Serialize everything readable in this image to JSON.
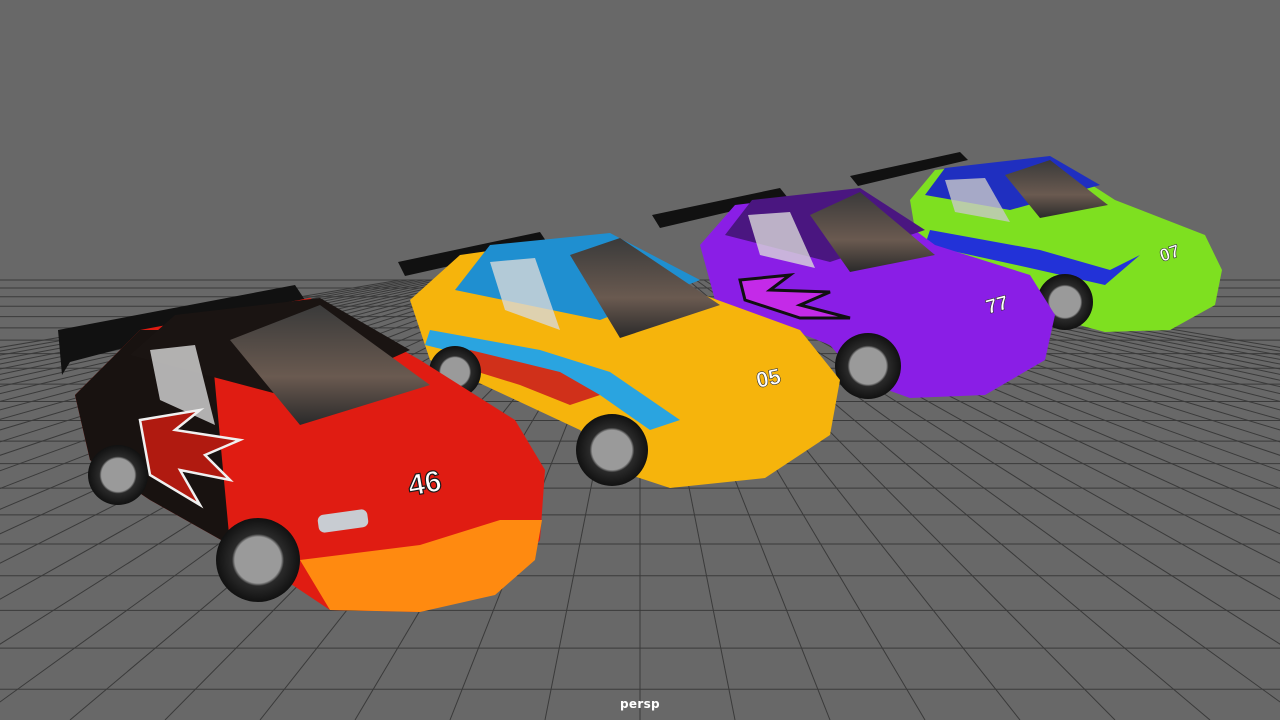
{
  "viewport": {
    "camera_label": "persp",
    "background_color": "#686868",
    "grid_color": "#3a3a3a"
  },
  "cars": [
    {
      "number": "46",
      "body_color": "#e01c12",
      "accent_color": "#ff8a10",
      "roof_color": "#1a1412",
      "decal": "flames"
    },
    {
      "number": "05",
      "body_color": "#f6b40c",
      "accent_color": "#2aa4e0",
      "roof_color": "#1f8fd0",
      "decal": "stripes"
    },
    {
      "number": "77",
      "body_color": "#8a1ee6",
      "accent_color": "#c42ae8",
      "roof_color": "#4a1680",
      "decal": "flames"
    },
    {
      "number": "07",
      "body_color": "#7ee020",
      "accent_color": "#2232d8",
      "roof_color": "#1f2fc0",
      "decal": "stripes"
    }
  ]
}
